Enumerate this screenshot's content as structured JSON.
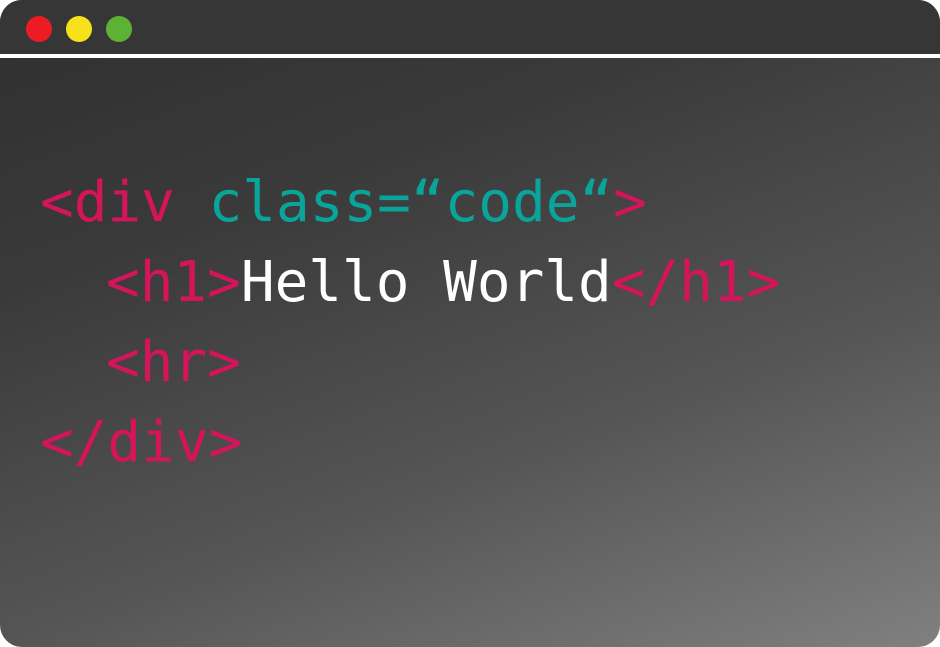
{
  "colors": {
    "tag": "#d5145a",
    "attribute": "#0aa59a",
    "text": "#ffffff",
    "close_dot": "#ed1c24",
    "minimize_dot": "#f7e11a",
    "maximize_dot": "#5db233"
  },
  "window": {
    "controls": [
      {
        "name": "close-button",
        "icon": "red-circle"
      },
      {
        "name": "minimize-button",
        "icon": "yellow-circle"
      },
      {
        "name": "maximize-button",
        "icon": "green-circle"
      }
    ]
  },
  "code": {
    "line1": {
      "open": "<div ",
      "attr": "class=“code“",
      "close": ">"
    },
    "line2": {
      "open": "<h1>",
      "text": "Hello World",
      "close": "</h1>"
    },
    "line3": {
      "tag": "<hr>"
    },
    "line4": {
      "tag": "</div>"
    }
  }
}
